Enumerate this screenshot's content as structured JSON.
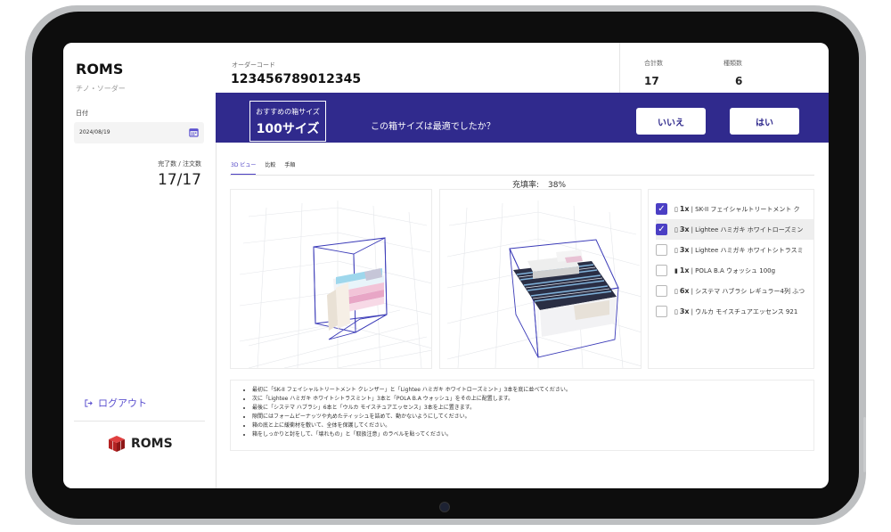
{
  "sidebar": {
    "app_title": "ROMS",
    "subtitle": "チノ・ソーダー",
    "date_label": "日付",
    "date_value": "2024/08/19",
    "completed_label": "完了数 / 注文数",
    "completed_value": "17/17",
    "logout_label": "ログアウト",
    "footer_brand": "ROMS"
  },
  "header": {
    "order_code_label": "オーダーコード",
    "order_code": "123456789012345",
    "total_label": "合計数",
    "total_value": "17",
    "kinds_label": "種類数",
    "kinds_value": "6"
  },
  "banner": {
    "recommend_label": "おすすめの箱サイズ",
    "recommend_size": "100サイズ",
    "question": "この箱サイズは最適でしたか？",
    "no_label": "いいえ",
    "yes_label": "はい"
  },
  "tabs": [
    {
      "label": "3D ビュー",
      "active": true
    },
    {
      "label": "比較",
      "active": false
    },
    {
      "label": "手順",
      "active": false
    }
  ],
  "fill_rate": {
    "label": "充填率:",
    "value": "38%"
  },
  "items": [
    {
      "checked": true,
      "qty": "1x",
      "name": "| SK-II フェイシャルトリートメント ク"
    },
    {
      "checked": true,
      "qty": "3x",
      "name": "| Lightee ハミガキ ホワイトローズミン"
    },
    {
      "checked": false,
      "qty": "3x",
      "name": "| Lightee ハミガキ ホワイトシトラスミ"
    },
    {
      "checked": false,
      "qty": "1x",
      "name": "| POLA B.A ウォッシュ 100g"
    },
    {
      "checked": false,
      "qty": "6x",
      "name": "| システマ ハブラシ レギュラー4列 ふつ"
    },
    {
      "checked": false,
      "qty": "3x",
      "name": "| ウルカ モイスチュアエッセンス 921"
    }
  ],
  "instructions": [
    "最初に「SK-II フェイシャルトリートメント クレンザー」と「Lightee ハミガキ ホワイトローズミント」3本を底に並べてください。",
    "次に「Lightee ハミガキ ホワイトシトラスミント」3本と「POLA B.A ウォッシュ」をその上に配置します。",
    "最後に「システマ ハブラシ」6本と「ウルカ モイスチュアエッセンス」3本を上に置きます。",
    "隙間にはフォームピーナッツや丸めたティッシュを詰めて、動かないようにしてください。",
    "箱の底と上に緩衝材を敷いて、全体を保護してください。",
    "箱をしっかりと封をして、「壊れもの」と「取扱注意」のラベルを貼ってください。"
  ],
  "colors": {
    "banner": "#302a8d",
    "accent": "#4b3fc4",
    "box_outline": "#3b3bb8"
  }
}
